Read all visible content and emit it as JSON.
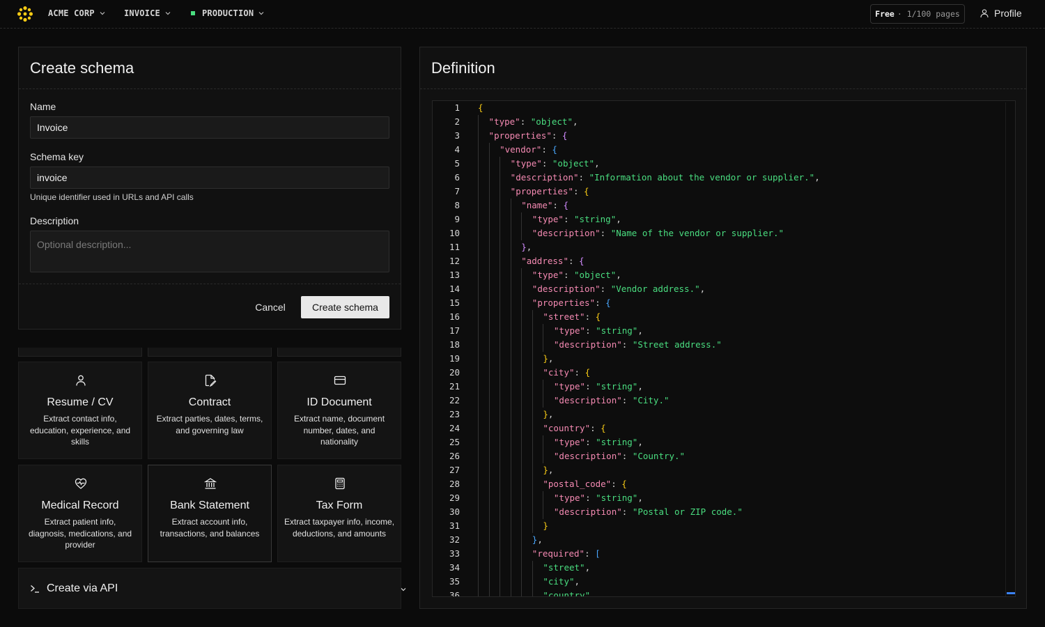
{
  "topbar": {
    "org": "ACME CORP",
    "schema": "INVOICE",
    "environment": "PRODUCTION",
    "plan": {
      "tier": "Free",
      "usage": "· 1/100 pages"
    },
    "profile": "Profile",
    "colors": {
      "env_dot": "#4ade80",
      "logo": "#facc15"
    }
  },
  "form": {
    "title": "Create schema",
    "name_label": "Name",
    "name_value": "Invoice",
    "key_label": "Schema key",
    "key_value": "invoice",
    "key_helper": "Unique identifier used in URLs and API calls",
    "description_label": "Description",
    "description_placeholder": "Optional description...",
    "cancel": "Cancel",
    "submit": "Create schema"
  },
  "templates": [
    {
      "icon": "user-icon",
      "title": "Resume / CV",
      "desc": "Extract contact info, education, experience, and skills"
    },
    {
      "icon": "file-pen-icon",
      "title": "Contract",
      "desc": "Extract parties, dates, terms, and governing law"
    },
    {
      "icon": "id-card-icon",
      "title": "ID Document",
      "desc": "Extract name, document number, dates, and nationality"
    },
    {
      "icon": "heart-pulse-icon",
      "title": "Medical Record",
      "desc": "Extract patient info, diagnosis, medications, and provider"
    },
    {
      "icon": "bank-icon",
      "title": "Bank Statement",
      "desc": "Extract account info, transactions, and balances"
    },
    {
      "icon": "calculator-icon",
      "title": "Tax Form",
      "desc": "Extract taxpayer info, income, deductions, and amounts"
    }
  ],
  "api": {
    "label": "Create via API"
  },
  "definition": {
    "title": "Definition",
    "lines": [
      {
        "n": "1",
        "indent": 0,
        "tokens": [
          [
            "b1",
            "{"
          ]
        ]
      },
      {
        "n": "2",
        "indent": 1,
        "tokens": [
          [
            "k",
            "\"type\""
          ],
          [
            "p",
            ": "
          ],
          [
            "s",
            "\"object\""
          ],
          [
            "p",
            ","
          ]
        ]
      },
      {
        "n": "3",
        "indent": 1,
        "tokens": [
          [
            "k",
            "\"properties\""
          ],
          [
            "p",
            ": "
          ],
          [
            "b2",
            "{"
          ]
        ]
      },
      {
        "n": "4",
        "indent": 2,
        "tokens": [
          [
            "k",
            "\"vendor\""
          ],
          [
            "p",
            ": "
          ],
          [
            "b3",
            "{"
          ]
        ]
      },
      {
        "n": "5",
        "indent": 3,
        "tokens": [
          [
            "k",
            "\"type\""
          ],
          [
            "p",
            ": "
          ],
          [
            "s",
            "\"object\""
          ],
          [
            "p",
            ","
          ]
        ]
      },
      {
        "n": "6",
        "indent": 3,
        "tokens": [
          [
            "k",
            "\"description\""
          ],
          [
            "p",
            ": "
          ],
          [
            "s",
            "\"Information about the vendor or supplier.\""
          ],
          [
            "p",
            ","
          ]
        ]
      },
      {
        "n": "7",
        "indent": 3,
        "tokens": [
          [
            "k",
            "\"properties\""
          ],
          [
            "p",
            ": "
          ],
          [
            "b1",
            "{"
          ]
        ]
      },
      {
        "n": "8",
        "indent": 4,
        "tokens": [
          [
            "k",
            "\"name\""
          ],
          [
            "p",
            ": "
          ],
          [
            "b2",
            "{"
          ]
        ]
      },
      {
        "n": "9",
        "indent": 5,
        "tokens": [
          [
            "k",
            "\"type\""
          ],
          [
            "p",
            ": "
          ],
          [
            "s",
            "\"string\""
          ],
          [
            "p",
            ","
          ]
        ]
      },
      {
        "n": "10",
        "indent": 5,
        "tokens": [
          [
            "k",
            "\"description\""
          ],
          [
            "p",
            ": "
          ],
          [
            "s",
            "\"Name of the vendor or supplier.\""
          ]
        ]
      },
      {
        "n": "11",
        "indent": 4,
        "tokens": [
          [
            "b2",
            "}"
          ],
          [
            "p",
            ","
          ]
        ]
      },
      {
        "n": "12",
        "indent": 4,
        "tokens": [
          [
            "k",
            "\"address\""
          ],
          [
            "p",
            ": "
          ],
          [
            "b2",
            "{"
          ]
        ]
      },
      {
        "n": "13",
        "indent": 5,
        "tokens": [
          [
            "k",
            "\"type\""
          ],
          [
            "p",
            ": "
          ],
          [
            "s",
            "\"object\""
          ],
          [
            "p",
            ","
          ]
        ]
      },
      {
        "n": "14",
        "indent": 5,
        "tokens": [
          [
            "k",
            "\"description\""
          ],
          [
            "p",
            ": "
          ],
          [
            "s",
            "\"Vendor address.\""
          ],
          [
            "p",
            ","
          ]
        ]
      },
      {
        "n": "15",
        "indent": 5,
        "tokens": [
          [
            "k",
            "\"properties\""
          ],
          [
            "p",
            ": "
          ],
          [
            "b3",
            "{"
          ]
        ]
      },
      {
        "n": "16",
        "indent": 6,
        "tokens": [
          [
            "k",
            "\"street\""
          ],
          [
            "p",
            ": "
          ],
          [
            "b1",
            "{"
          ]
        ]
      },
      {
        "n": "17",
        "indent": 7,
        "tokens": [
          [
            "k",
            "\"type\""
          ],
          [
            "p",
            ": "
          ],
          [
            "s",
            "\"string\""
          ],
          [
            "p",
            ","
          ]
        ]
      },
      {
        "n": "18",
        "indent": 7,
        "tokens": [
          [
            "k",
            "\"description\""
          ],
          [
            "p",
            ": "
          ],
          [
            "s",
            "\"Street address.\""
          ]
        ]
      },
      {
        "n": "19",
        "indent": 6,
        "tokens": [
          [
            "b1",
            "}"
          ],
          [
            "p",
            ","
          ]
        ]
      },
      {
        "n": "20",
        "indent": 6,
        "tokens": [
          [
            "k",
            "\"city\""
          ],
          [
            "p",
            ": "
          ],
          [
            "b1",
            "{"
          ]
        ]
      },
      {
        "n": "21",
        "indent": 7,
        "tokens": [
          [
            "k",
            "\"type\""
          ],
          [
            "p",
            ": "
          ],
          [
            "s",
            "\"string\""
          ],
          [
            "p",
            ","
          ]
        ]
      },
      {
        "n": "22",
        "indent": 7,
        "tokens": [
          [
            "k",
            "\"description\""
          ],
          [
            "p",
            ": "
          ],
          [
            "s",
            "\"City.\""
          ]
        ]
      },
      {
        "n": "23",
        "indent": 6,
        "tokens": [
          [
            "b1",
            "}"
          ],
          [
            "p",
            ","
          ]
        ]
      },
      {
        "n": "24",
        "indent": 6,
        "tokens": [
          [
            "k",
            "\"country\""
          ],
          [
            "p",
            ": "
          ],
          [
            "b1",
            "{"
          ]
        ]
      },
      {
        "n": "25",
        "indent": 7,
        "tokens": [
          [
            "k",
            "\"type\""
          ],
          [
            "p",
            ": "
          ],
          [
            "s",
            "\"string\""
          ],
          [
            "p",
            ","
          ]
        ]
      },
      {
        "n": "26",
        "indent": 7,
        "tokens": [
          [
            "k",
            "\"description\""
          ],
          [
            "p",
            ": "
          ],
          [
            "s",
            "\"Country.\""
          ]
        ]
      },
      {
        "n": "27",
        "indent": 6,
        "tokens": [
          [
            "b1",
            "}"
          ],
          [
            "p",
            ","
          ]
        ]
      },
      {
        "n": "28",
        "indent": 6,
        "tokens": [
          [
            "k",
            "\"postal_code\""
          ],
          [
            "p",
            ": "
          ],
          [
            "b1",
            "{"
          ]
        ]
      },
      {
        "n": "29",
        "indent": 7,
        "tokens": [
          [
            "k",
            "\"type\""
          ],
          [
            "p",
            ": "
          ],
          [
            "s",
            "\"string\""
          ],
          [
            "p",
            ","
          ]
        ]
      },
      {
        "n": "30",
        "indent": 7,
        "tokens": [
          [
            "k",
            "\"description\""
          ],
          [
            "p",
            ": "
          ],
          [
            "s",
            "\"Postal or ZIP code.\""
          ]
        ]
      },
      {
        "n": "31",
        "indent": 6,
        "tokens": [
          [
            "b1",
            "}"
          ]
        ]
      },
      {
        "n": "32",
        "indent": 5,
        "tokens": [
          [
            "b3",
            "}"
          ],
          [
            "p",
            ","
          ]
        ]
      },
      {
        "n": "33",
        "indent": 5,
        "tokens": [
          [
            "k",
            "\"required\""
          ],
          [
            "p",
            ": "
          ],
          [
            "b3",
            "["
          ]
        ]
      },
      {
        "n": "34",
        "indent": 6,
        "tokens": [
          [
            "s",
            "\"street\""
          ],
          [
            "p",
            ","
          ]
        ]
      },
      {
        "n": "35",
        "indent": 6,
        "tokens": [
          [
            "s",
            "\"city\""
          ],
          [
            "p",
            ","
          ]
        ]
      },
      {
        "n": "36",
        "indent": 6,
        "tokens": [
          [
            "s",
            "\"country\""
          ],
          [
            "p",
            ","
          ]
        ]
      }
    ]
  }
}
